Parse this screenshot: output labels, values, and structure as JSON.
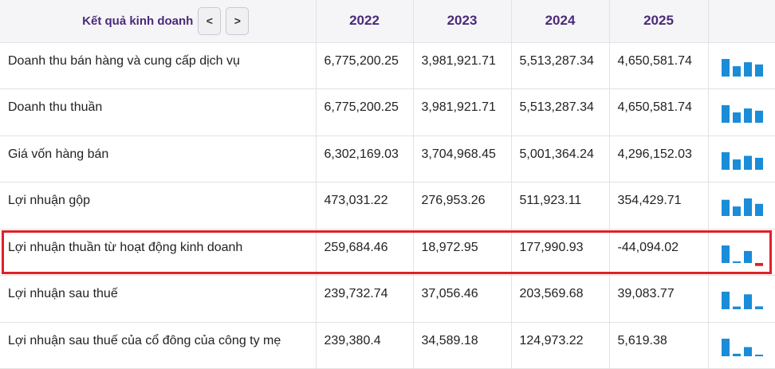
{
  "header": {
    "title": "Kết quả kinh doanh",
    "prev_label": "<",
    "next_label": ">",
    "years": [
      "2022",
      "2023",
      "2024",
      "2025"
    ]
  },
  "colors": {
    "bar_positive": "#1a8cd8",
    "bar_negative": "#e0202a",
    "highlight": "#e0202a",
    "header_text": "#4a2a78"
  },
  "rows": [
    {
      "label": "Doanh thu bán hàng và cung cấp dịch vụ",
      "values": [
        "6,775,200.25",
        "3,981,921.71",
        "5,513,287.34",
        "4,650,581.74"
      ],
      "numbers": [
        6775200.25,
        3981921.71,
        5513287.34,
        4650581.74
      ]
    },
    {
      "label": "Doanh thu thuần",
      "values": [
        "6,775,200.25",
        "3,981,921.71",
        "5,513,287.34",
        "4,650,581.74"
      ],
      "numbers": [
        6775200.25,
        3981921.71,
        5513287.34,
        4650581.74
      ]
    },
    {
      "label": "Giá vốn hàng bán",
      "values": [
        "6,302,169.03",
        "3,704,968.45",
        "5,001,364.24",
        "4,296,152.03"
      ],
      "numbers": [
        6302169.03,
        3704968.45,
        5001364.24,
        4296152.03
      ]
    },
    {
      "label": "Lợi nhuận gộp",
      "values": [
        "473,031.22",
        "276,953.26",
        "511,923.11",
        "354,429.71"
      ],
      "numbers": [
        473031.22,
        276953.26,
        511923.11,
        354429.71
      ]
    },
    {
      "label": "Lợi nhuận thuần từ hoạt động kinh doanh",
      "values": [
        "259,684.46",
        "18,972.95",
        "177,990.93",
        "-44,094.02"
      ],
      "numbers": [
        259684.46,
        18972.95,
        177990.93,
        -44094.02
      ],
      "highlighted": true
    },
    {
      "label": "Lợi nhuận sau thuế",
      "values": [
        "239,732.74",
        "37,056.46",
        "203,569.68",
        "39,083.77"
      ],
      "numbers": [
        239732.74,
        37056.46,
        203569.68,
        39083.77
      ]
    },
    {
      "label": "Lợi nhuận sau thuế của cổ đông của công ty mẹ",
      "values": [
        "239,380.4",
        "34,589.18",
        "124,973.22",
        "5,619.38"
      ],
      "numbers": [
        239380.4,
        34589.18,
        124973.22,
        5619.38
      ]
    }
  ]
}
